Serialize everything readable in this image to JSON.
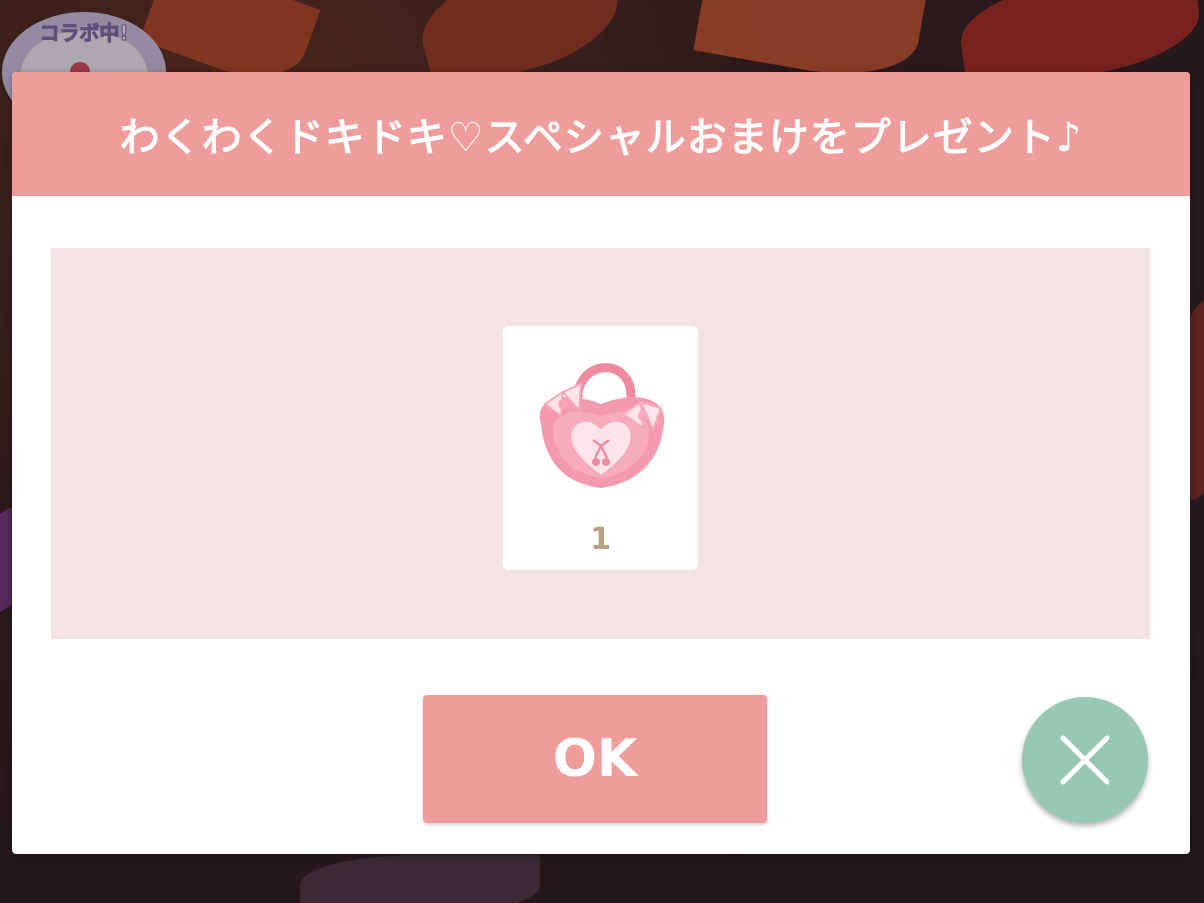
{
  "background": {
    "collab_badge_text": "コラボ中!"
  },
  "dialog": {
    "title": "わくわくドキドキ♡スペシャルおまけをプレゼント♪",
    "reward": {
      "item_icon": "pink-heart-handbag-icon",
      "quantity": "1"
    },
    "ok_label": "OK",
    "close_icon": "close-icon"
  },
  "colors": {
    "header": "#ef9c9c",
    "panel": "#f3e3e3",
    "ok_button": "#ef9c9c",
    "close_button": "#98c8b4",
    "quantity_text": "#b8a080"
  }
}
